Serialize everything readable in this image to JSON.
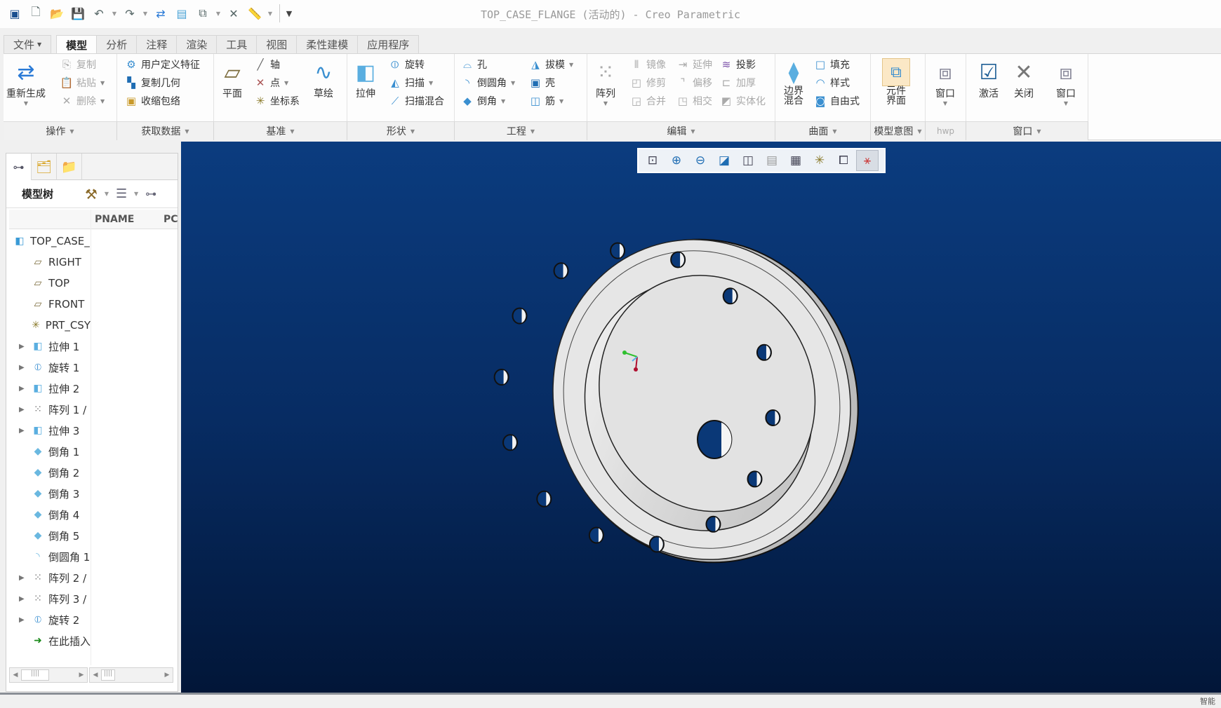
{
  "window": {
    "title": "TOP_CASE_FLANGE (活动的) - Creo Parametric"
  },
  "quick_access": [
    {
      "name": "app-icon"
    },
    {
      "name": "new-icon"
    },
    {
      "name": "open-icon"
    },
    {
      "name": "save-icon"
    },
    {
      "name": "undo-icon"
    },
    {
      "name": "redo-icon"
    },
    {
      "name": "regenerate-icon"
    },
    {
      "name": "windows-icon"
    },
    {
      "name": "close-window-icon"
    },
    {
      "name": "measure-icon"
    }
  ],
  "tabs": [
    "文件",
    "模型",
    "分析",
    "注释",
    "渲染",
    "工具",
    "视图",
    "柔性建模",
    "应用程序"
  ],
  "active_tab": "模型",
  "ribbon": {
    "operations": {
      "label": "操作",
      "regenerate": "重新生成",
      "copy": "复制",
      "paste": "粘贴",
      "delete": "删除"
    },
    "get_data": {
      "label": "获取数据",
      "udf": "用户定义特征",
      "copy_geom": "复制几何",
      "shrinkwrap": "收缩包络"
    },
    "datum": {
      "label": "基准",
      "plane": "平面",
      "axis": "轴",
      "point": "点",
      "csys": "坐标系",
      "sketch": "草绘"
    },
    "shapes": {
      "label": "形状",
      "extrude": "拉伸",
      "revolve": "旋转",
      "sweep": "扫描",
      "swept_blend": "扫描混合"
    },
    "engineering": {
      "label": "工程",
      "hole": "孔",
      "round": "倒圆角",
      "chamfer": "倒角",
      "draft": "拔模",
      "shell": "壳",
      "rib": "筋"
    },
    "editing": {
      "label": "编辑",
      "pattern": "阵列",
      "mirror": "镜像",
      "trim": "修剪",
      "merge": "合并",
      "extend": "延伸",
      "offset": "偏移",
      "intersect": "相交",
      "project": "投影",
      "thicken": "加厚",
      "solidify": "实体化"
    },
    "surfaces": {
      "label": "曲面",
      "boundary_blend": "边界混合",
      "fill": "填充",
      "style": "样式",
      "freestyle": "自由式"
    },
    "model_intent": {
      "label": "模型意图",
      "component_interface": "元件界面"
    },
    "hwp": {
      "label": "hwp",
      "window": "窗口"
    },
    "window": {
      "label": "窗口",
      "activate": "激活",
      "close": "关闭",
      "windows": "窗口"
    }
  },
  "left_panel": {
    "tree_label": "模型树",
    "columns": [
      "PNAME",
      "PC"
    ],
    "items": [
      {
        "label": "TOP_CASE_",
        "icon": "part-icon",
        "expandable": false,
        "root": true
      },
      {
        "label": "RIGHT",
        "icon": "datum-plane-icon",
        "expandable": false
      },
      {
        "label": "TOP",
        "icon": "datum-plane-icon",
        "expandable": false
      },
      {
        "label": "FRONT",
        "icon": "datum-plane-icon",
        "expandable": false
      },
      {
        "label": "PRT_CSY",
        "icon": "csys-icon",
        "expandable": false
      },
      {
        "label": "拉伸 1",
        "icon": "extrude-icon",
        "expandable": true
      },
      {
        "label": "旋转 1",
        "icon": "revolve-icon",
        "expandable": true
      },
      {
        "label": "拉伸 2",
        "icon": "extrude-icon",
        "expandable": true
      },
      {
        "label": "阵列 1 /",
        "icon": "pattern-icon",
        "expandable": true
      },
      {
        "label": "拉伸 3",
        "icon": "extrude-icon",
        "expandable": true
      },
      {
        "label": "倒角 1",
        "icon": "chamfer-icon",
        "expandable": false
      },
      {
        "label": "倒角 2",
        "icon": "chamfer-icon",
        "expandable": false
      },
      {
        "label": "倒角 3",
        "icon": "chamfer-icon",
        "expandable": false
      },
      {
        "label": "倒角 4",
        "icon": "chamfer-icon",
        "expandable": false
      },
      {
        "label": "倒角 5",
        "icon": "chamfer-icon",
        "expandable": false
      },
      {
        "label": "倒圆角 1",
        "icon": "round-icon",
        "expandable": false
      },
      {
        "label": "阵列 2 /",
        "icon": "pattern-icon",
        "expandable": true
      },
      {
        "label": "阵列 3 /",
        "icon": "pattern-icon",
        "expandable": true
      },
      {
        "label": "旋转 2",
        "icon": "revolve-icon",
        "expandable": true
      },
      {
        "label": "在此插入",
        "icon": "insert-here-icon",
        "expandable": false
      }
    ]
  },
  "view_toolbar": [
    "refit-icon",
    "zoom-in-icon",
    "zoom-out-icon",
    "repaint-icon",
    "display-style-icon",
    "saved-orientations-icon",
    "view-manager-icon",
    "datum-display-icon",
    "annotation-display-icon",
    "spin-center-icon"
  ],
  "status": {
    "right_text": "智能"
  },
  "colors": {
    "viewport_top": "#0b3c7f",
    "viewport_bottom": "#021638",
    "part": "#e2e2e2"
  }
}
